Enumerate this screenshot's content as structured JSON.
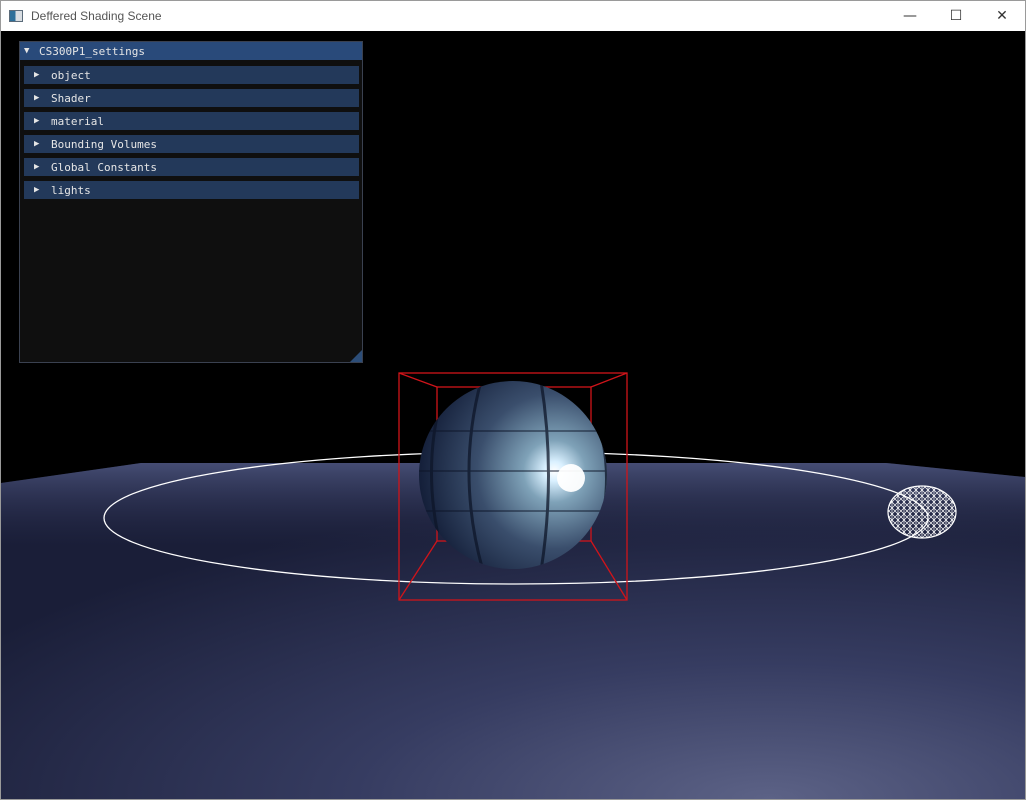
{
  "window": {
    "title": "Deffered Shading Scene",
    "controls": {
      "minimize": "—",
      "maximize": "☐",
      "close": "✕"
    }
  },
  "settings_panel": {
    "title": "CS300P1_settings",
    "collapse_arrow": "▼",
    "item_arrow": "▶",
    "items": [
      {
        "label": "object"
      },
      {
        "label": "Shader"
      },
      {
        "label": "material"
      },
      {
        "label": "Bounding Volumes"
      },
      {
        "label": "Global Constants"
      },
      {
        "label": "lights"
      }
    ]
  },
  "colors": {
    "panel_title": "#294a7a",
    "panel_header": "#23395a",
    "panel_bg": "#101010",
    "bounding_box": "#d0141a",
    "orbit": "#ffffff"
  }
}
